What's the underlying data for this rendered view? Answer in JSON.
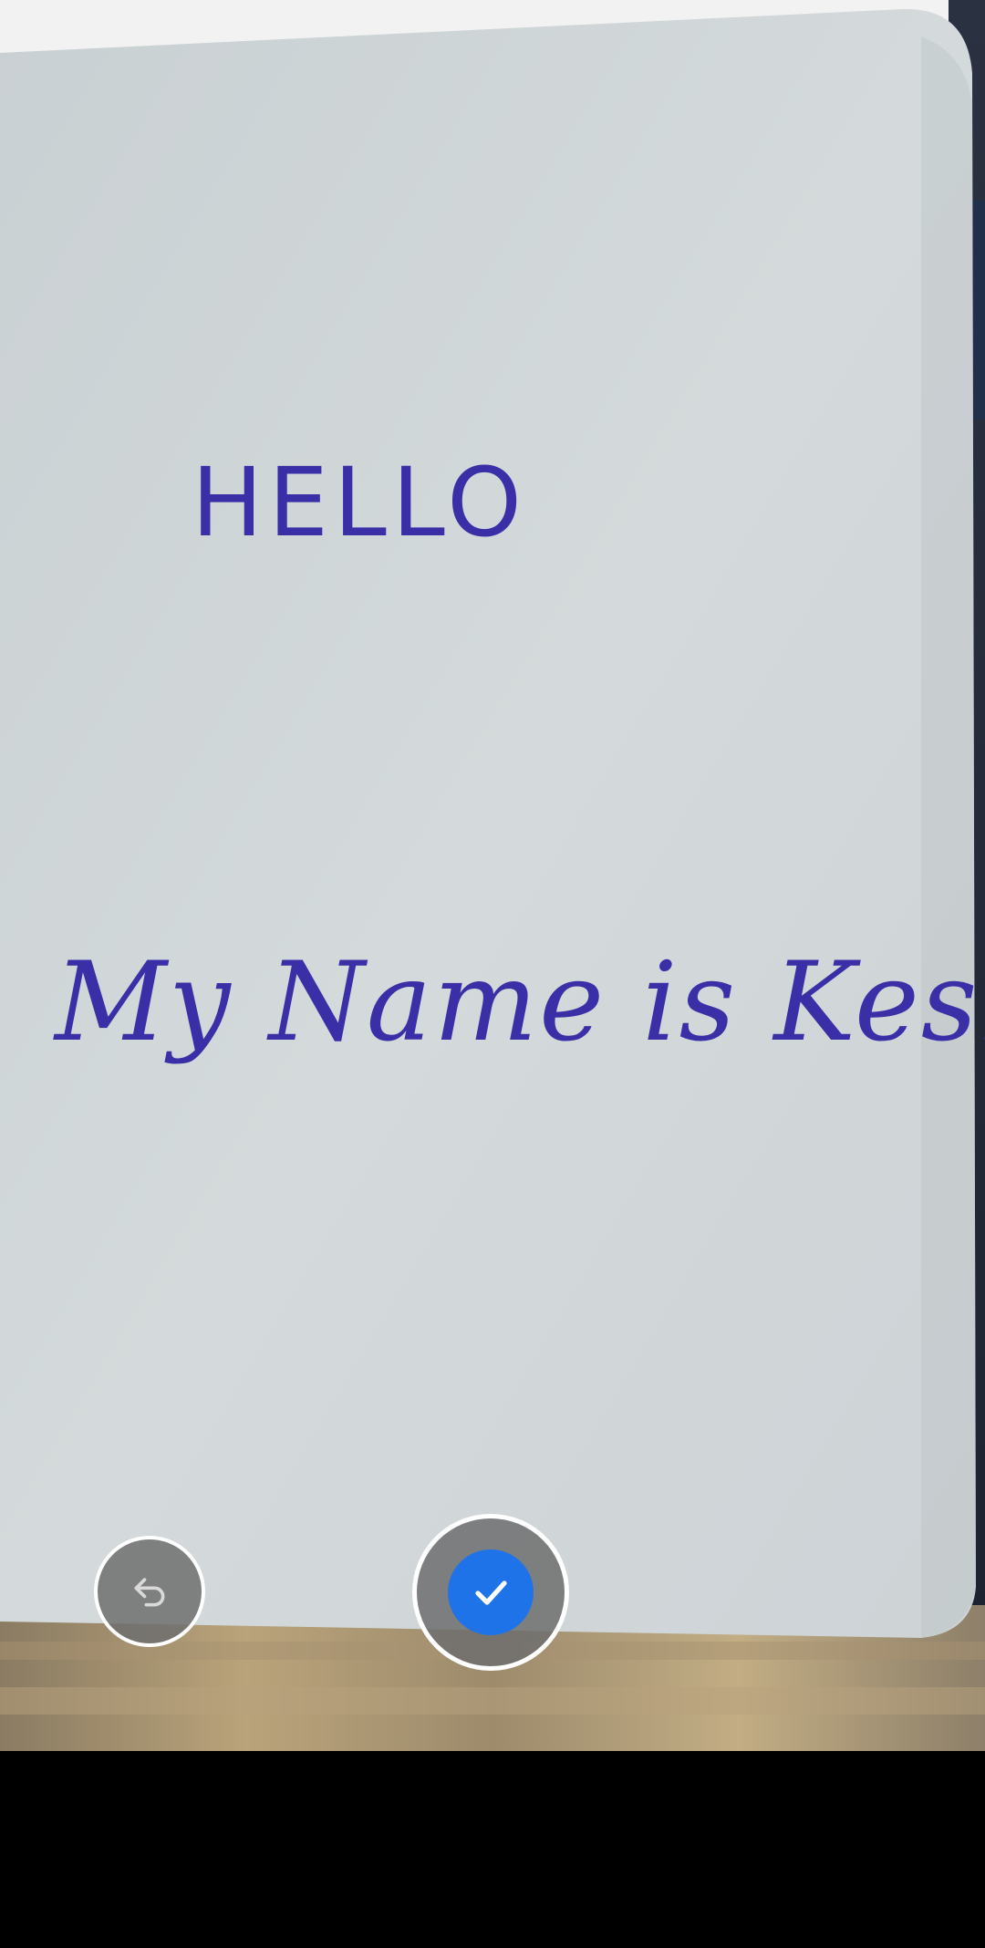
{
  "preview": {
    "line1": "HELLO",
    "line2": "My Name is Keshav"
  },
  "controls": {
    "retake_icon": "undo-icon",
    "confirm_icon": "check-icon",
    "confirm_color": "#1f73e8"
  }
}
